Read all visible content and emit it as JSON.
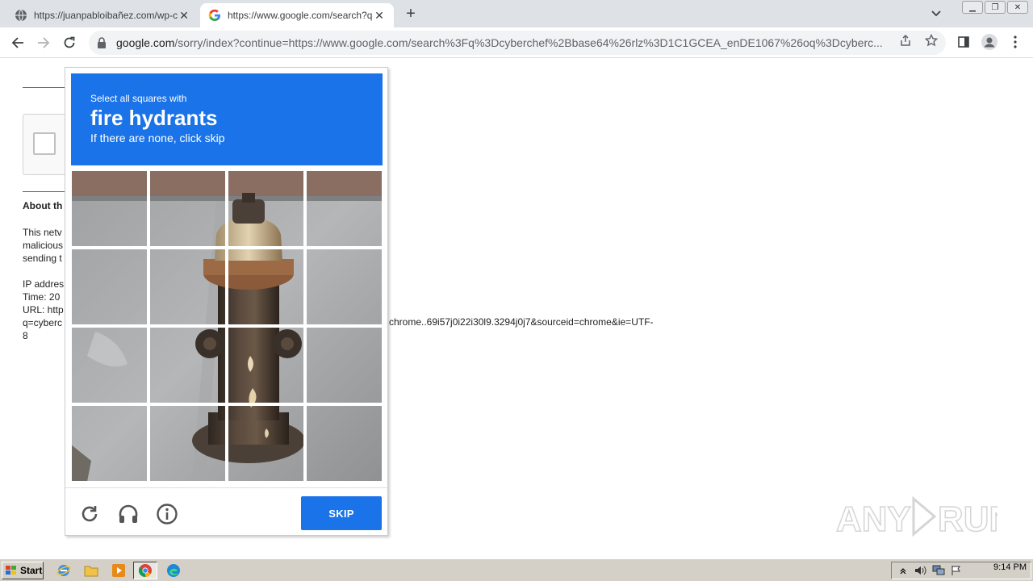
{
  "browser": {
    "tabs": [
      {
        "title": "https://juanpabloibañez.com/wp-content",
        "active": false
      },
      {
        "title": "https://www.google.com/search?q=cyberchef",
        "active": true
      }
    ],
    "omnibox": {
      "host": "google.com",
      "path": "/sorry/index?continue=https://www.google.com/search%3Fq%3Dcyberchef%2Bbase64%26rlz%3D1C1GCEA_enDE1067%26oq%3Dcyberc..."
    }
  },
  "page": {
    "about_title": "About th",
    "para_lines": [
      "This netv",
      "malicious",
      "sending t"
    ],
    "ip_line": "IP addres",
    "time_line": "Time: 20",
    "url_line": "URL: http",
    "q_line": "q=cyberc",
    "url_tail": "chrome..69i57j0i22i30l9.3294j0j7&sourceid=chrome&ie=UTF-",
    "last_line": "8"
  },
  "challenge": {
    "instruction": "Select all squares with",
    "object": "fire hydrants",
    "hint": "If there are none, click skip",
    "skip_label": "SKIP",
    "accent": "#1a73e8"
  },
  "taskbar": {
    "start_label": "Start",
    "clock": "9:14 PM"
  },
  "watermark": "ANY RUN"
}
